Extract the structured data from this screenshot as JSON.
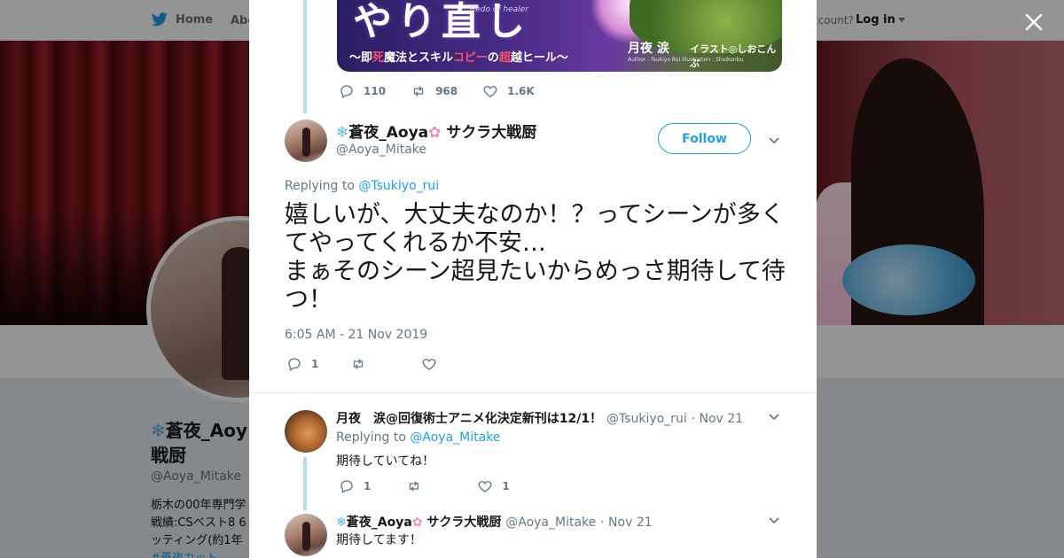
{
  "colors": {
    "accent": "#1da1f2",
    "text": "#14171a",
    "muted": "#657786",
    "thread": "#b9dcf2"
  },
  "topnav": {
    "home_label": "Home",
    "about_label": "Abo",
    "account_prompt": "ccount?",
    "login_label": "Log in"
  },
  "profile": {
    "name_line1": "蒼夜_Aoy",
    "name_line2": "戦厨",
    "handle": "@Aoya_Mitake",
    "bio_lines": [
      "栃木の00年専門学",
      "戦績:CSベスト8 6",
      "ッティング(約1年",
      "#蒼夜カット"
    ]
  },
  "media": {
    "title": "やり直し",
    "title_en": "Redo of healer",
    "subtitle_pre": "〜即",
    "subtitle_red1": "死",
    "subtitle_mid": "魔法とスキル",
    "subtitle_red2": "コピー",
    "subtitle_mid2": "の",
    "subtitle_red3": "超",
    "subtitle_post": "越ヒール〜",
    "author": "月夜 涙",
    "illustrator": "イラスト◎しおこんぶ",
    "credit_en": "Author : Tsukiyo Rui    Illustration : Shiokonbu"
  },
  "prev_tweet_actions": {
    "replies": "110",
    "retweets": "968",
    "likes": "1.6K"
  },
  "main_tweet": {
    "display_name": "蒼夜_Aoya",
    "name_suffix": " サクラ大戦厨",
    "handle": "@Aoya_Mitake",
    "follow_label": "Follow",
    "replying_prefix": "Replying to ",
    "replying_to": "@Tsukiyo_rui",
    "text": "嬉しいが、大丈夫なのか！？ってシーンが多くてやってくれるか不安…\nまぁそのシーン超見たいからめっさ期待して待つ！",
    "timestamp": "6:05 AM - 21 Nov 2019",
    "replies": "1",
    "retweets": "",
    "likes": ""
  },
  "replies": [
    {
      "display_name": "月夜　涙@回復術士アニメ化決定新刊は12/1！",
      "handle": "@Tsukiyo_rui",
      "date": "· Nov 21",
      "replying_prefix": "Replying to ",
      "replying_to": "@Aoya_Mitake",
      "text": "期待していてね！",
      "replies": "1",
      "retweets": "",
      "likes": "1"
    },
    {
      "display_name": "蒼夜_Aoya",
      "name_suffix": " サクラ大戦厨",
      "handle": "@Aoya_Mitake",
      "date": "· Nov 21",
      "text": "期待してます！"
    }
  ]
}
